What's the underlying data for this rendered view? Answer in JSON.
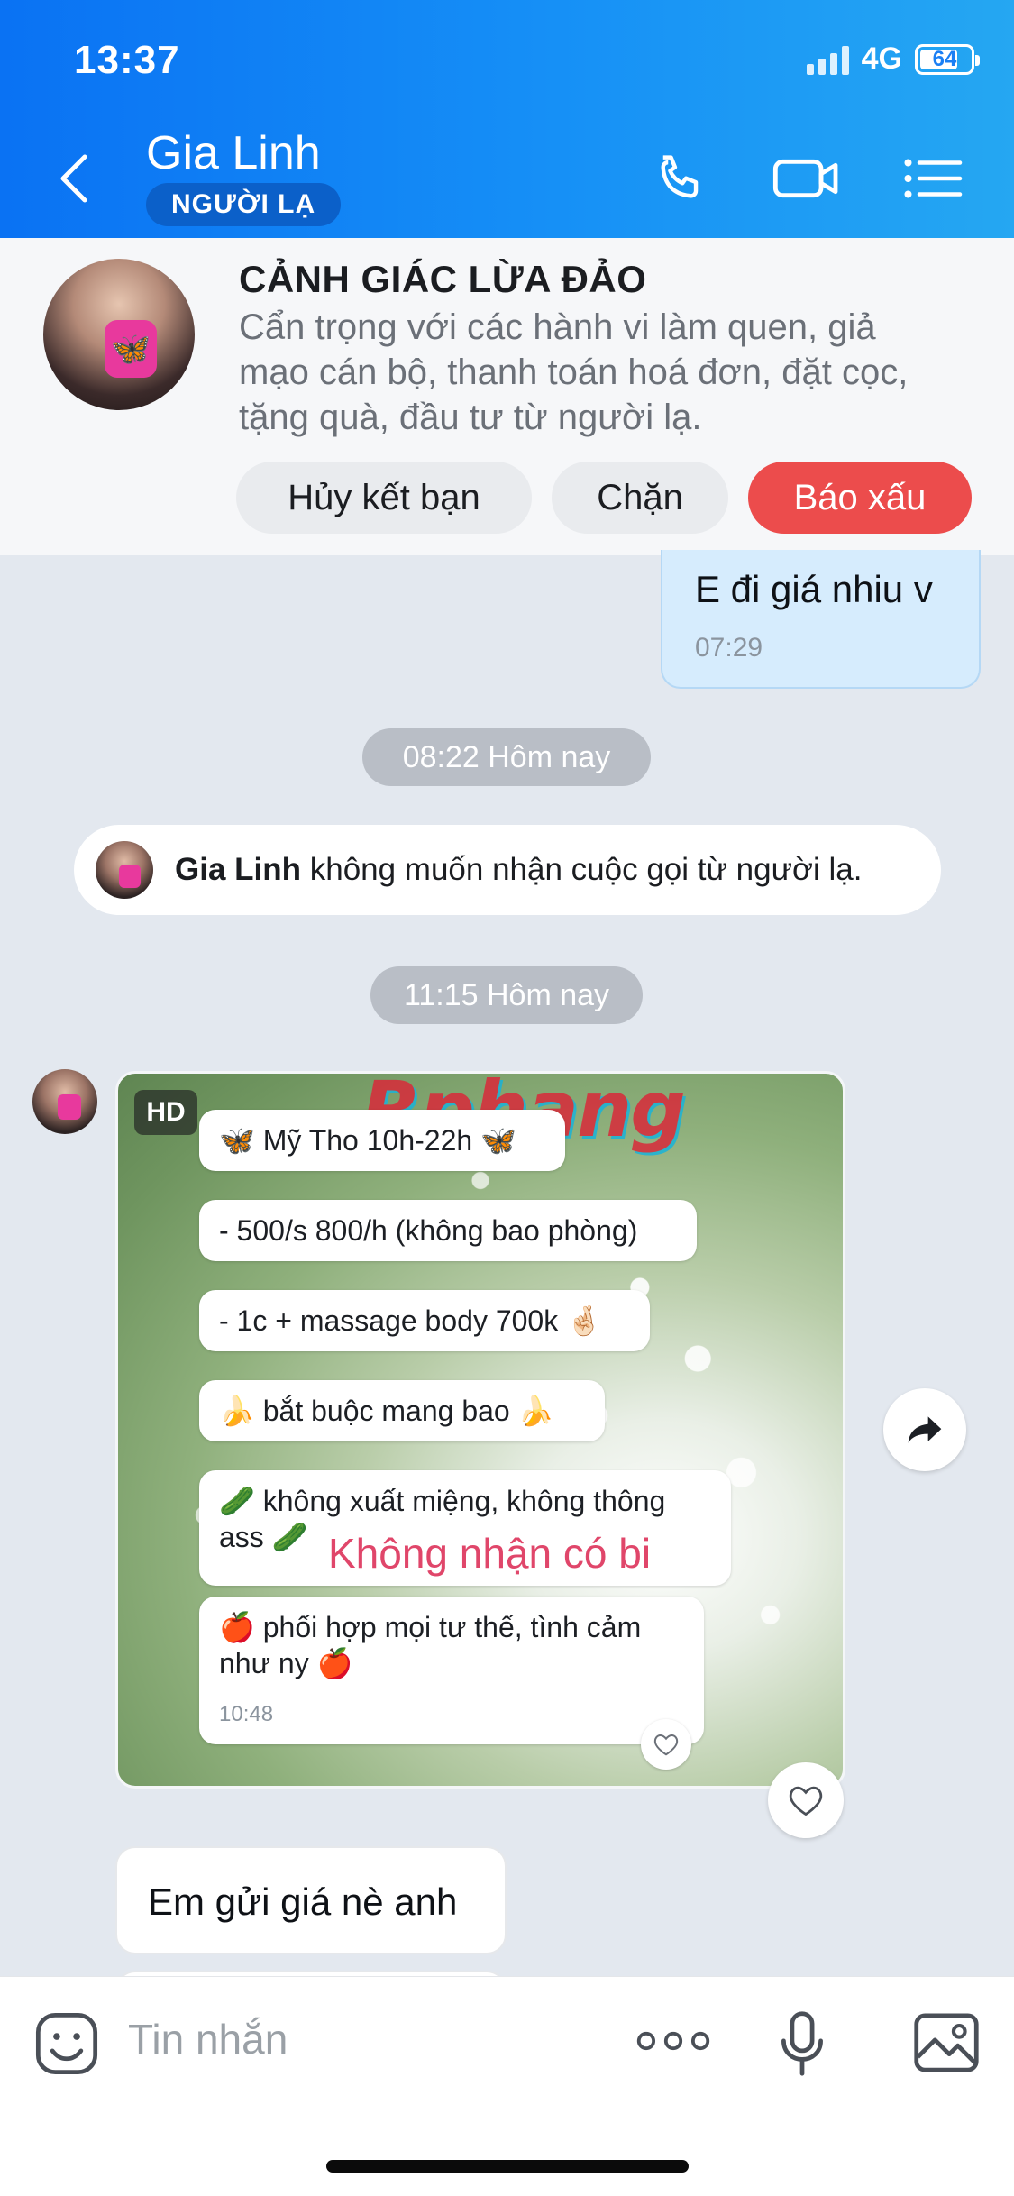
{
  "status_bar": {
    "time": "13:37",
    "network": "4G",
    "battery": "64"
  },
  "header": {
    "contact_name": "Gia Linh",
    "badge": "NGƯỜI LẠ"
  },
  "warning": {
    "title": "CẢNH GIÁC LỪA ĐẢO",
    "lines": [
      "Cẩn trọng với các hành vi làm quen, giả",
      "mạo cán bộ, thanh toán hoá đơn, đặt cọc,",
      "tặng quà, đầu tư từ người lạ."
    ],
    "buttons": {
      "unfriend": "Hủy kết bạn",
      "block": "Chặn",
      "report": "Báo xấu"
    }
  },
  "messages": {
    "outgoing": {
      "text": "E đi giá nhiu v",
      "time": "07:29"
    },
    "chip_1": "08:22 Hôm nay",
    "notice": {
      "name": "Gia Linh",
      "text": " không muốn nhận cuộc gọi từ người lạ."
    },
    "chip_2": "11:15 Hôm nay",
    "photo": {
      "hd": "HD",
      "watermark": "Rphang",
      "lines": [
        "🦋 Mỹ Tho 10h-22h 🦋",
        "- 500/s 800/h (không bao phòng)",
        "- 1c + massage body 700k 🤞🏻",
        "🍌 bắt buộc mang bao 🍌",
        "🥒 không xuất miệng, không thông",
        "ass 🥒",
        "🍎 phối hợp mọi tư thế, tình cảm",
        "như ny 🍎"
      ],
      "overlay_text": "Không nhận có bi",
      "inner_time": "10:48"
    },
    "incoming": {
      "text": "Em gửi giá nè anh"
    }
  },
  "composer": {
    "placeholder": "Tin nhắn"
  },
  "colors": {
    "header_start": "#0a72f3",
    "header_end": "#25a7f2",
    "report": "#ec4c4c",
    "outgoing_bubble": "#d6ecfd"
  },
  "icons": [
    "back-icon",
    "phone-icon",
    "video-call-icon",
    "menu-list-icon",
    "share-icon",
    "heart-icon",
    "sticker-icon",
    "more-icon",
    "microphone-icon",
    "image-icon"
  ]
}
